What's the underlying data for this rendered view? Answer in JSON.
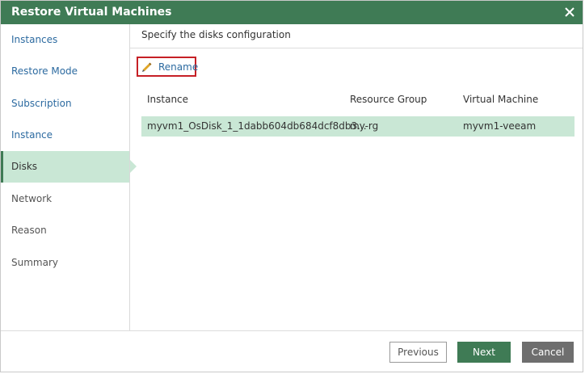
{
  "window": {
    "title": "Restore Virtual Machines",
    "close_icon": "close-icon"
  },
  "wizard_steps": [
    {
      "label": "Instances",
      "state": "link"
    },
    {
      "label": "Restore Mode",
      "state": "link"
    },
    {
      "label": "Subscription",
      "state": "link"
    },
    {
      "label": "Instance",
      "state": "link"
    },
    {
      "label": "Disks",
      "state": "active"
    },
    {
      "label": "Network",
      "state": "inactive"
    },
    {
      "label": "Reason",
      "state": "inactive"
    },
    {
      "label": "Summary",
      "state": "inactive"
    }
  ],
  "main": {
    "section_title": "Specify the disks configuration",
    "rename": {
      "label": "Rename",
      "icon": "pencil-icon"
    },
    "table": {
      "columns": [
        "Instance",
        "Resource Group",
        "Virtual Machine"
      ],
      "rows": [
        {
          "instance": "myvm1_OsDisk_1_1dabb604db684dcf8db3...",
          "resource_group": "my-rg",
          "virtual_machine": "myvm1-veeam",
          "selected": true
        }
      ]
    }
  },
  "buttons": {
    "previous": "Previous",
    "next": "Next",
    "cancel": "Cancel"
  },
  "colors": {
    "title_bar": "#3f7b55",
    "selection": "#c9e7d5",
    "link": "#2c6aa0",
    "highlight_box": "#c62026",
    "cancel": "#6e6e6e"
  }
}
